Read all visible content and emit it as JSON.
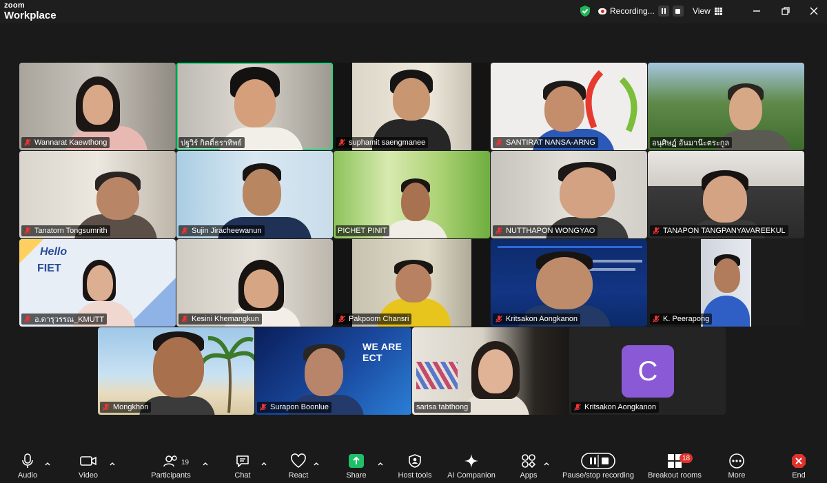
{
  "app": {
    "brand_top": "zoom",
    "brand_bottom": "Workplace",
    "recording_label": "Recording...",
    "view_label": "View"
  },
  "colors": {
    "active_speaker": "#23d97c",
    "recording_dot": "#e02828",
    "badge": "#e0312c",
    "avatar_bg": "#8a5ad6",
    "share_green": "#1fbf6a",
    "end_red": "#e0312c"
  },
  "participants": [
    {
      "name": "Wannarat Kaewthong"
    },
    {
      "name": "ปฐวิร์ กิตติ์ธราทิพย์"
    },
    {
      "name": "suphamit saengmanee"
    },
    {
      "name": "SANTIRAT NANSA-ARNG"
    },
    {
      "name": "อนุศิษฏ์ อันมาน๊ะตระกูล"
    },
    {
      "name": "Tanatorn Tongsumrith"
    },
    {
      "name": "Sujin Jiracheewanun"
    },
    {
      "name": "PICHET PINIT"
    },
    {
      "name": "NUTTHAPON WONGYAO"
    },
    {
      "name": "TANAPON TANGPANYAVAREEKUL"
    },
    {
      "name": "อ.ดารุวรรณ_KMUTT"
    },
    {
      "name": "Kesini Khemangkun"
    },
    {
      "name": "Pakpoom Chansri"
    },
    {
      "name": "Kritsakon Aongkanon"
    },
    {
      "name": "K. Peerapong"
    },
    {
      "name": "Mongkhon"
    },
    {
      "name": "Surapon Boonlue"
    },
    {
      "name": "sarisa tabthong"
    },
    {
      "name": "Kritsakon Aongkanon"
    }
  ],
  "avatar_letter": "C",
  "backgrounds": {
    "fiet_hello": "Hello",
    "fiet_name": "FIET",
    "ect_banner": "WE ARE ECT"
  },
  "toolbar": {
    "audio": "Audio",
    "video": "Video",
    "participants": "Participants",
    "participants_count": "19",
    "chat": "Chat",
    "react": "React",
    "share": "Share",
    "host_tools": "Host tools",
    "ai_companion": "AI Companion",
    "apps": "Apps",
    "pause_stop": "Pause/stop recording",
    "breakout": "Breakout rooms",
    "breakout_badge": "18",
    "more": "More",
    "end": "End"
  }
}
